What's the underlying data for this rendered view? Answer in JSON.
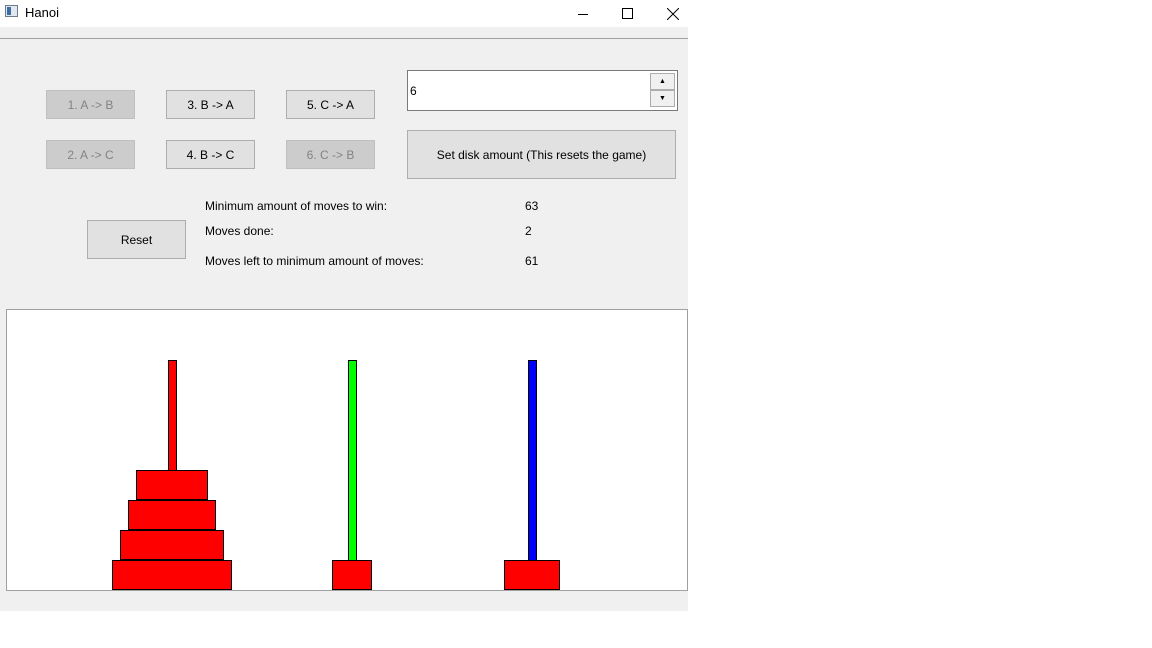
{
  "window": {
    "title": "Hanoi"
  },
  "title_controls": {
    "minimize": "─",
    "maximize": "☐",
    "close": "✕"
  },
  "moves": {
    "a_to_b": {
      "label": "1.  A -> B",
      "enabled": false
    },
    "a_to_c": {
      "label": "2.  A -> C",
      "enabled": false
    },
    "b_to_a": {
      "label": "3.  B -> A",
      "enabled": true
    },
    "b_to_c": {
      "label": "4.  B -> C",
      "enabled": true
    },
    "c_to_a": {
      "label": "5.  C -> A",
      "enabled": true
    },
    "c_to_b": {
      "label": "6.  C -> B",
      "enabled": false
    }
  },
  "disk_amount": {
    "value": "6",
    "up": "▲",
    "down": "▼",
    "set_label": "Set disk amount (This resets the game)"
  },
  "reset_label": "Reset",
  "stats": {
    "min_moves_label": "Minimum amount of moves to win:",
    "min_moves_value": "63",
    "moves_done_label": "Moves done:",
    "moves_done_value": "2",
    "moves_left_label": "Moves left to minimum amount of moves:",
    "moves_left_value": "61"
  },
  "board": {
    "pegs": [
      {
        "name": "A",
        "color": "#ff0000",
        "disks": [
          6,
          5,
          4,
          3
        ]
      },
      {
        "name": "B",
        "color": "#00ff00",
        "disks": [
          1
        ]
      },
      {
        "name": "C",
        "color": "#0000ff",
        "disks": [
          2
        ]
      }
    ],
    "disk_color": "#ff0000"
  }
}
